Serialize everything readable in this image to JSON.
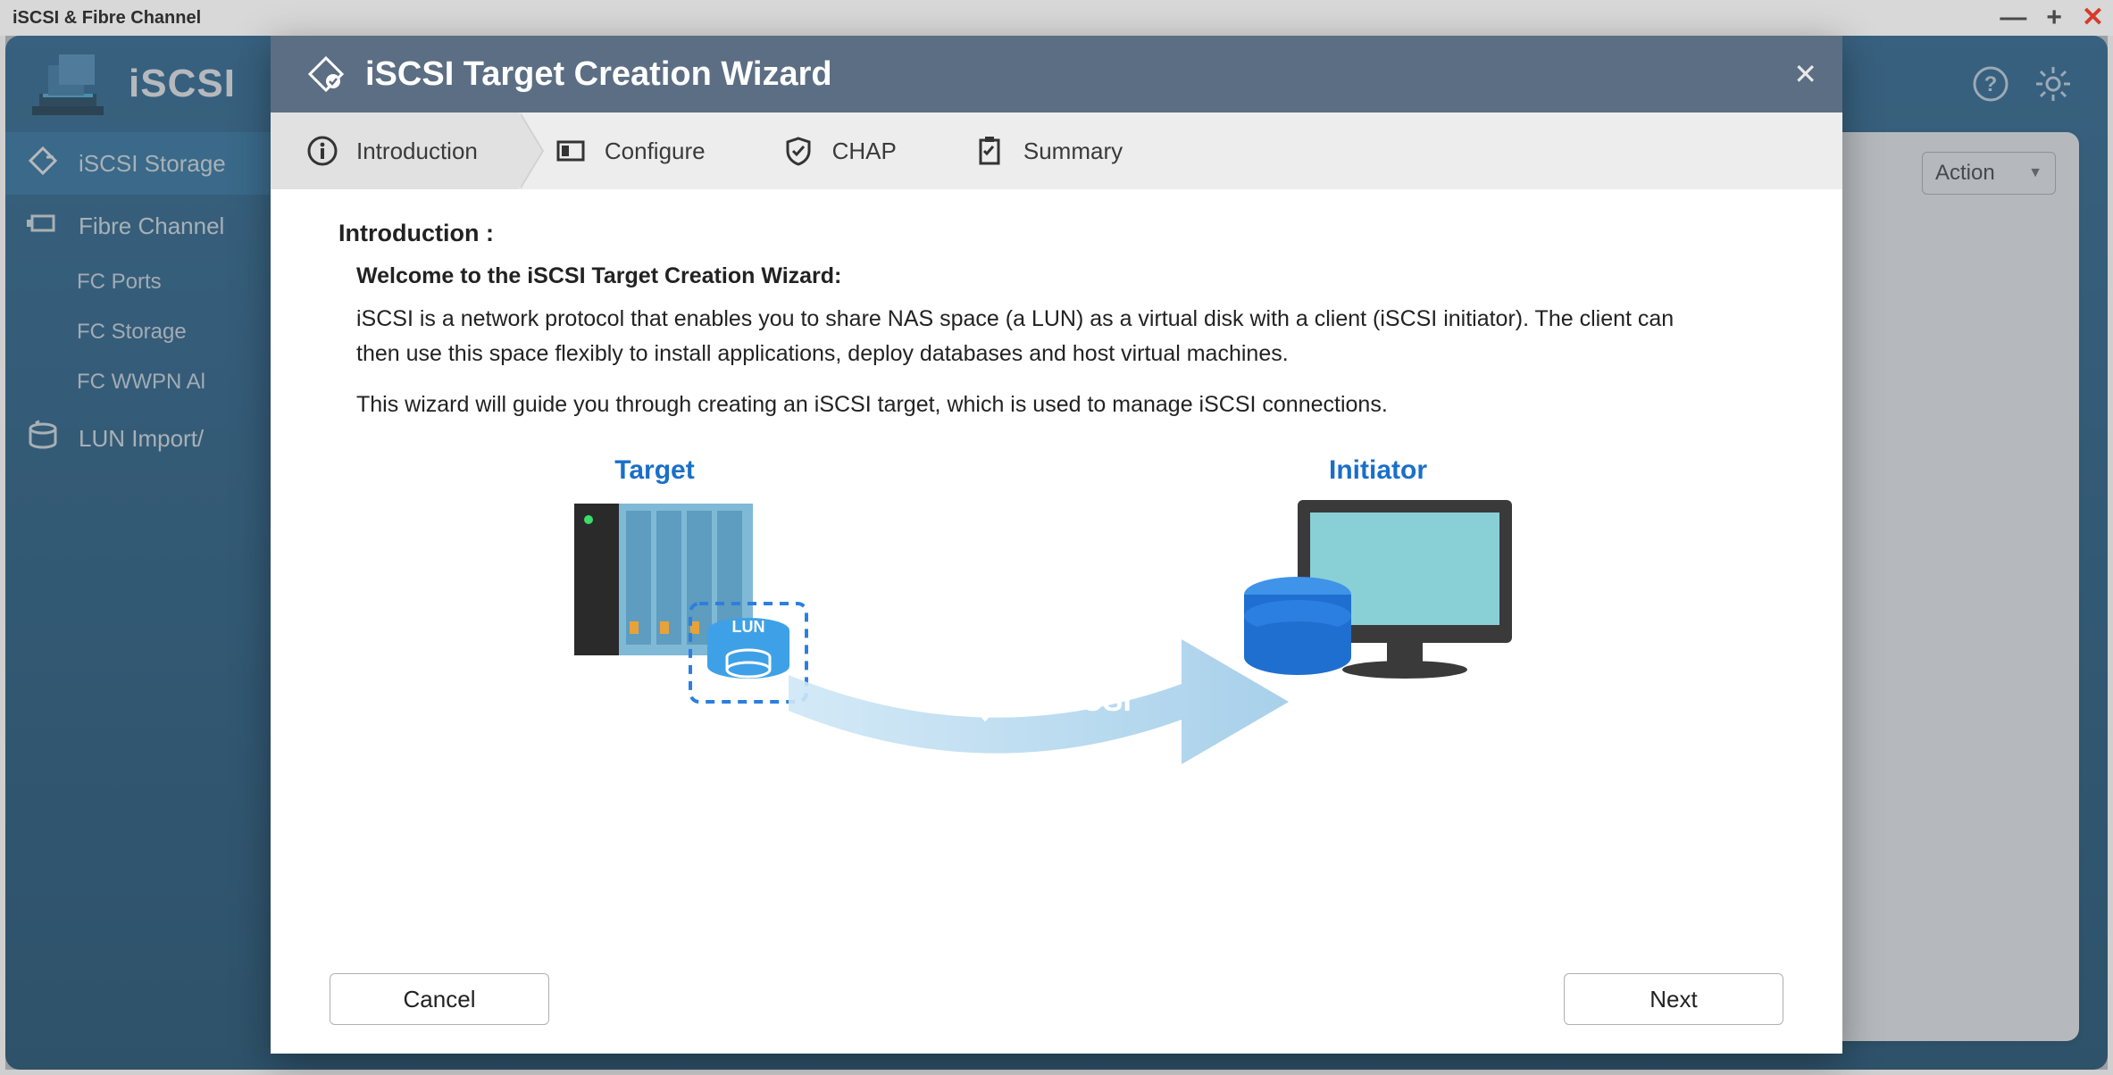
{
  "window": {
    "title": "iSCSI & Fibre Channel"
  },
  "app": {
    "brand": "iSCSI"
  },
  "sidebar": {
    "items": [
      {
        "label": "iSCSI Storage"
      },
      {
        "label": "Fibre Channel"
      },
      {
        "label": "LUN Import/"
      }
    ],
    "fc_children": [
      {
        "label": "FC Ports"
      },
      {
        "label": "FC Storage"
      },
      {
        "label": "FC WWPN Al"
      }
    ]
  },
  "main": {
    "action_label": "Action"
  },
  "modal": {
    "title": "iSCSI Target Creation Wizard",
    "steps": [
      {
        "label": "Introduction"
      },
      {
        "label": "Configure"
      },
      {
        "label": "CHAP"
      },
      {
        "label": "Summary"
      }
    ],
    "intro": {
      "heading": "Introduction :",
      "welcome": "Welcome to the iSCSI Target Creation Wizard:",
      "para1": "iSCSI is a network protocol that enables you to share NAS space (a LUN) as a virtual disk with a client (iSCSI initiator). The client can then use this space flexibly to install applications, deploy databases and host virtual machines.",
      "para2": "This wizard will guide you through creating an iSCSI target, which is used to manage iSCSI connections.",
      "diagram": {
        "target_label": "Target",
        "initiator_label": "Initiator",
        "arrow_label": "iSCSI",
        "lun_label": "LUN"
      }
    },
    "buttons": {
      "cancel": "Cancel",
      "next": "Next"
    }
  }
}
